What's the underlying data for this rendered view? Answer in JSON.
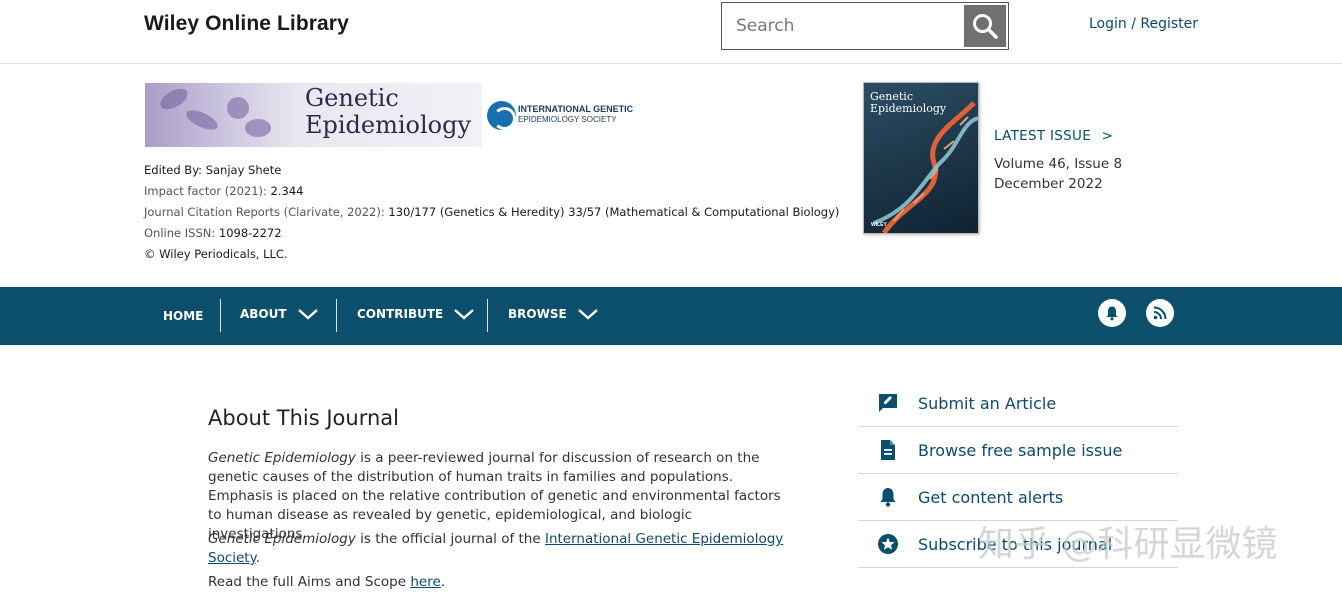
{
  "header": {
    "brand": "Wiley Online Library",
    "search_placeholder": "Search",
    "login_label": "Login / Register"
  },
  "journal": {
    "banner_title_line1": "Genetic",
    "banner_title_line2": "Epidemiology",
    "society_line1": "INTERNATIONAL GENETIC",
    "society_line2": "EPIDEMIOLOGY SOCIETY",
    "edited_by_label": "Edited By:",
    "edited_by": "Sanjay Shete",
    "impact_label": "Impact factor (2021):",
    "impact_value": "2.344",
    "jcr_label": "Journal Citation Reports (Clarivate, 2022):",
    "jcr_rank1": "130/177 (Genetics & Heredity)",
    "jcr_rank2": "33/57 (Mathematical & Computational Biology)",
    "issn_label": "Online ISSN:",
    "issn_value": "1098-2272",
    "copyright": "© Wiley Periodicals, LLC."
  },
  "cover": {
    "title_line1": "Genetic",
    "title_line2": "Epidemiology",
    "publisher": "WILEY"
  },
  "latest_issue": {
    "label": "LATEST ISSUE",
    "arrow": ">",
    "volume": "Volume 46, Issue 8",
    "date": "December 2022"
  },
  "nav": {
    "home": "HOME",
    "about": "ABOUT",
    "contribute": "CONTRIBUTE",
    "browse": "BROWSE"
  },
  "about": {
    "heading": "About This Journal",
    "p1_journal": "Genetic Epidemiology",
    "p1_text": " is a peer-reviewed journal for discussion of research on the genetic causes of the distribution of human traits in families and populations. Emphasis is placed on the relative contribution of genetic and environmental factors to human disease as revealed by genetic, epidemiological, and biologic investigations.",
    "p2_journal": "Genetic Epidemiology",
    "p2_text": " is the official journal of the ",
    "p2_link": "International Genetic Epidemiology Society",
    "p2_end": ".",
    "p3_text": "Read the full Aims and Scope ",
    "p3_link": "here",
    "p3_end": "."
  },
  "sidebar": {
    "items": [
      {
        "label": "Submit an Article",
        "icon": "edit-icon"
      },
      {
        "label": "Browse free sample issue",
        "icon": "document-icon"
      },
      {
        "label": "Get content alerts",
        "icon": "bell-icon"
      },
      {
        "label": "Subscribe to this journal",
        "icon": "star-icon"
      }
    ]
  },
  "watermark": "知乎 @科研显微镜",
  "colors": {
    "nav_bg": "#0b4f6c",
    "link": "#0a4a6e"
  }
}
